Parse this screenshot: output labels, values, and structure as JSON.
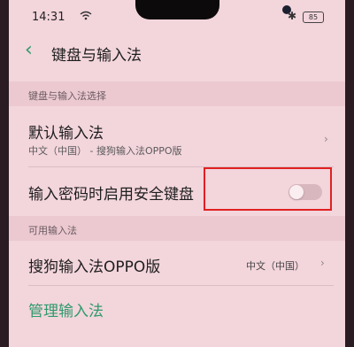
{
  "status_bar": {
    "time": "14:31",
    "battery": "85",
    "icons": [
      "wifi-icon",
      "bluetooth-icon",
      "battery-icon"
    ]
  },
  "header": {
    "back_glyph": "‹",
    "title": "键盘与输入法"
  },
  "sections": [
    {
      "label": "键盘与输入法选择"
    },
    {
      "label": "可用输入法"
    }
  ],
  "default_ime": {
    "title": "默认输入法",
    "subtitle": "中文（中国） - 搜狗输入法OPPO版"
  },
  "secure_keyboard": {
    "label": "输入密码时启用安全键盘",
    "enabled": false
  },
  "available_ime": {
    "title": "搜狗输入法OPPO版",
    "value": "中文（中国）"
  },
  "manage": {
    "label": "管理输入法"
  },
  "colors": {
    "accent": "#2e9a6b",
    "highlight_box": "#e02020",
    "background": "#f3d5dc"
  }
}
